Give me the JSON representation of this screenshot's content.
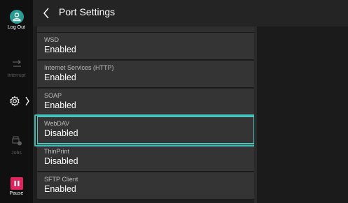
{
  "sidebar": {
    "logout_label": "Log Out",
    "interrupt_label": "Interrupt",
    "jobs_label": "Jobs",
    "pause_label": "Pause"
  },
  "header": {
    "title": "Port Settings"
  },
  "ports": [
    {
      "label": "WSD",
      "value": "Enabled"
    },
    {
      "label": "Internet Services (HTTP)",
      "value": "Enabled"
    },
    {
      "label": "SOAP",
      "value": "Enabled"
    },
    {
      "label": "WebDAV",
      "value": "Disabled"
    },
    {
      "label": "ThinPrint",
      "value": "Disabled"
    },
    {
      "label": "SFTP Client",
      "value": "Enabled"
    }
  ],
  "colors": {
    "accent": "#3fbab3",
    "logout": "#2a9a92",
    "pause": "#e0245e"
  }
}
